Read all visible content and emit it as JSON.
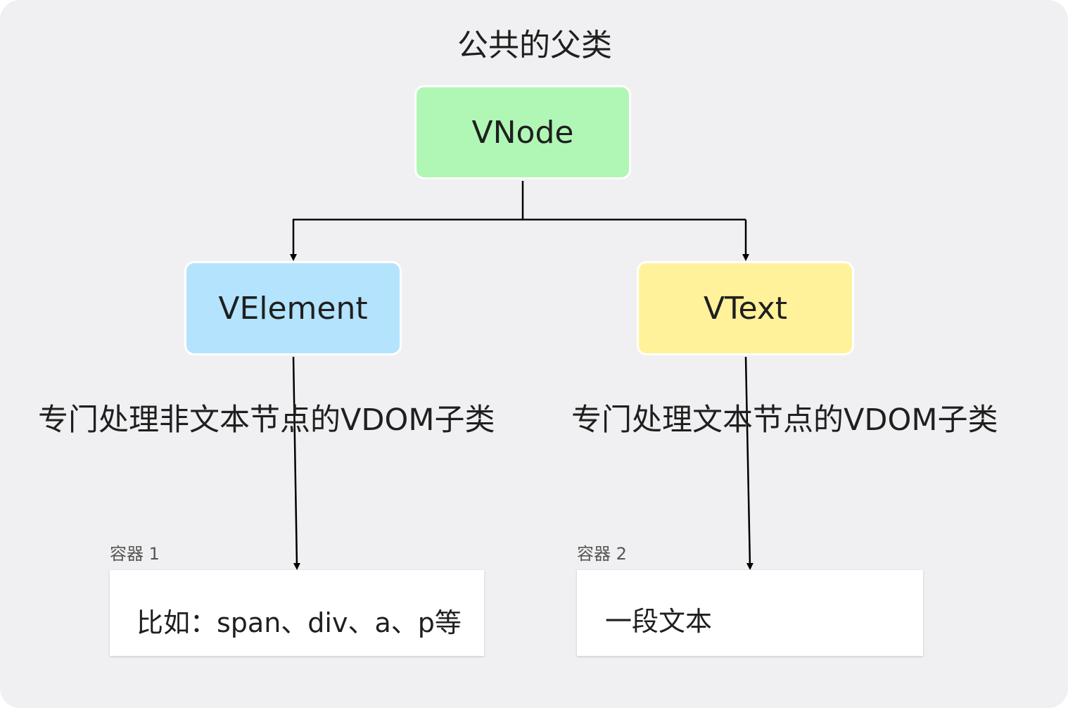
{
  "title": "公共的父类",
  "nodes": {
    "root": {
      "label": "VNode",
      "color": "#b0f7b5"
    },
    "left": {
      "label": "VElement",
      "color": "#b3e3fd"
    },
    "right": {
      "label": "VText",
      "color": "#fff29a"
    }
  },
  "descriptions": {
    "left": "专门处理非文本节点的VDOM子类",
    "right": "专门处理文本节点的VDOM子类"
  },
  "containers": [
    {
      "label": "容器 1",
      "content": "比如：span、div、a、p等"
    },
    {
      "label": "容器 2",
      "content": "一段文本"
    }
  ],
  "colors": {
    "background": "#f0f0f2",
    "line": "#000000"
  }
}
